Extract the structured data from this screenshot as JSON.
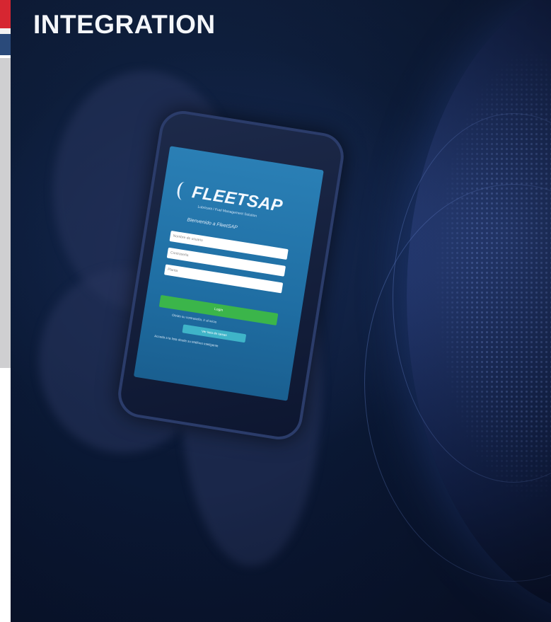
{
  "header": {
    "title": "INTEGRATION"
  },
  "phone_screen": {
    "logo_text": "FLEETSAP",
    "tagline": "Lubricant / Fuel Management Solution",
    "welcome": "Bienvenido a FleetSAP",
    "username_placeholder": "Nombre de usuario",
    "password_placeholder": "Contraseña",
    "plant_placeholder": "Planta",
    "login_label": "Login",
    "forgot_label": "Olvido su contraseña. Ir al inicio",
    "secondary_label": "Ver lista de tareas",
    "footer_text": "Acceda a la lista desde su teléfono inteligente"
  },
  "colors": {
    "accent_red": "#d62631",
    "navy": "#2a4a7a",
    "login_green": "#3bb54a",
    "secondary_teal": "#3fb4c8",
    "screen_blue": "#2a7fb5"
  },
  "icons": {
    "logo": "fleetsap-logo-icon",
    "globe": "globe-icon"
  }
}
